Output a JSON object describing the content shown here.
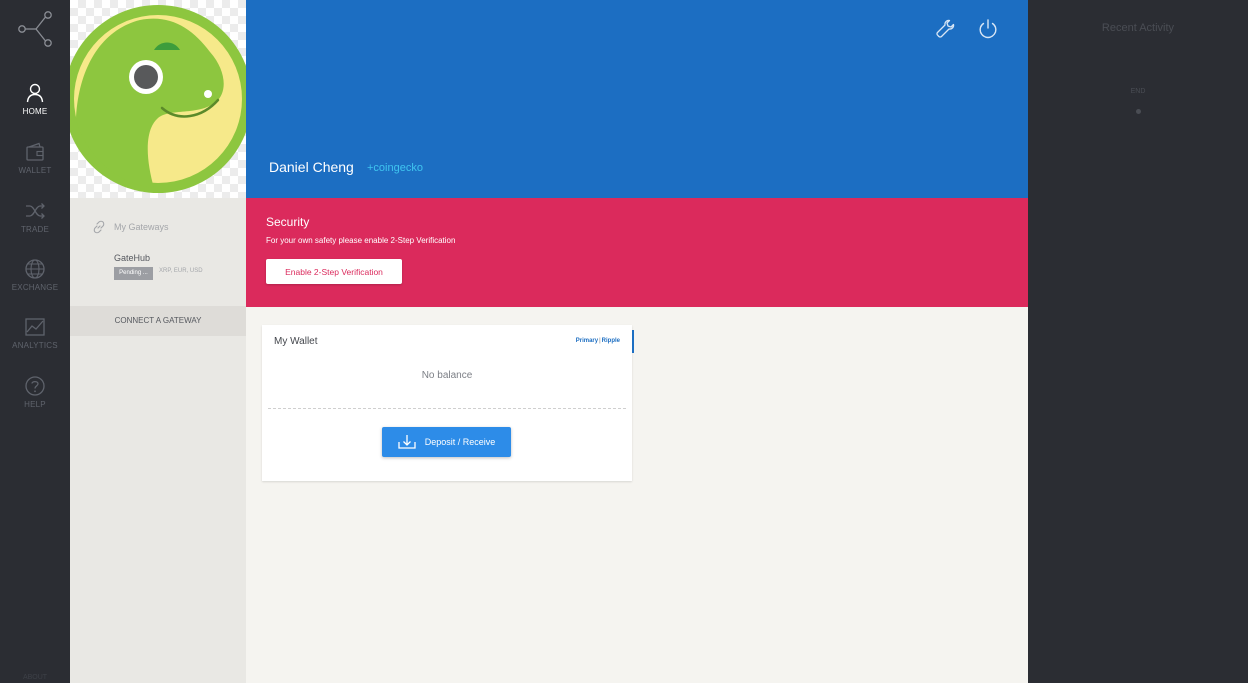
{
  "nav": {
    "logo_icon": "network-nodes-icon",
    "items": [
      {
        "label": "HOME",
        "icon": "user-icon",
        "active": true
      },
      {
        "label": "WALLET",
        "icon": "wallet-icon",
        "active": false
      },
      {
        "label": "TRADE",
        "icon": "shuffle-icon",
        "active": false
      },
      {
        "label": "EXCHANGE",
        "icon": "globe-icon",
        "active": false
      },
      {
        "label": "ANALYTICS",
        "icon": "chart-line-icon",
        "active": false
      },
      {
        "label": "HELP",
        "icon": "question-icon",
        "active": false
      }
    ],
    "footer": "ABOUT"
  },
  "profile": {
    "name": "Daniel Cheng",
    "handle": "+coingecko",
    "avatar_icon": "coingecko-gecko-avatar"
  },
  "gateways": {
    "title": "My Gateways",
    "title_icon": "link-icon",
    "items": [
      {
        "name": "GateHub",
        "status": "Pending ...",
        "currencies": "XRP, EUR, USD"
      }
    ],
    "connect_label": "CONNECT A GATEWAY"
  },
  "header_icons": {
    "settings": "wrench-icon",
    "power": "power-icon"
  },
  "security": {
    "title": "Security",
    "description": "For your own safety please enable 2-Step Verification",
    "button_label": "Enable 2-Step Verification"
  },
  "wallet": {
    "title": "My Wallet",
    "tab_primary": "Primary",
    "tab_separator": "|",
    "tab_ripple": "Ripple",
    "empty_text": "No balance",
    "deposit_label": "Deposit / Receive",
    "deposit_icon": "download-tray-icon"
  },
  "activity": {
    "title": "Recent Activity",
    "end_label": "END"
  },
  "colors": {
    "hero": "#1c6ec2",
    "security": "#db2a5c",
    "accent": "#2d8ce8",
    "handle": "#3fc5f0",
    "nav_bg": "#2b2d33"
  }
}
